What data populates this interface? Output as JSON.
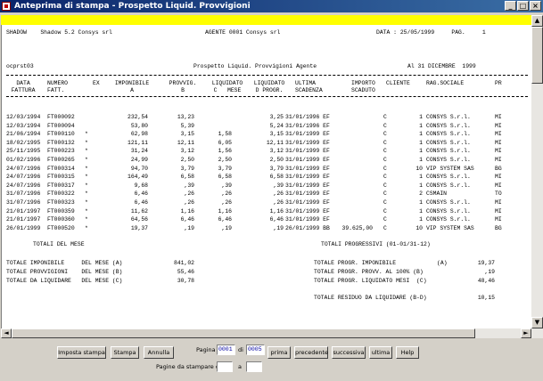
{
  "window": {
    "title": "Anteprima di stampa - Prospetto Liquid. Provvigioni"
  },
  "report": {
    "header_left": "SHADOW    Shadow 5.2 Consys srl",
    "header_mid": "AGENTE 0001 Consys srl",
    "header_right": "DATA : 25/05/1999     PAG.     1",
    "prog": "ocprst03",
    "title": "Prospetto Liquid. Provvigioni Agente",
    "period": "Al 31 DICEMBRE  1999",
    "columns": [
      {
        "l1": "DATA",
        "l2": "FATTURA"
      },
      {
        "l1": "NUMERO",
        "l2": "FATT."
      },
      {
        "l1": "EX",
        "l2": ""
      },
      {
        "l1": "IMPONIBILE",
        "l2": "A"
      },
      {
        "l1": "PROVVIG.",
        "l2": "B"
      },
      {
        "l1": "LIQUIDATO",
        "l2": "C   MESE"
      },
      {
        "l1": "LIQUIDATO",
        "l2": "D PROGR."
      },
      {
        "l1": "ULTIMA",
        "l2": "SCADENZA"
      },
      {
        "l1": "IMPORTO",
        "l2": "SCADUTO"
      },
      {
        "l1": "CLIENTE",
        "l2": ""
      },
      {
        "l1": "RAG.SOCIALE",
        "l2": ""
      },
      {
        "l1": "PR",
        "l2": ""
      }
    ],
    "rows": [
      {
        "data": "12/03/1994",
        "num": "FT000092",
        "ex": "",
        "imp": "232,54",
        "prov": "13,23",
        "liqm": "",
        "liqp": "3,25",
        "scad": "31/01/1996 EF",
        "scaduto": "",
        "c": "C",
        "cli": "1",
        "rag": "CONSYS S.r.l.",
        "pr": "MI"
      },
      {
        "data": "12/03/1994",
        "num": "FT000094",
        "ex": "",
        "imp": "53,80",
        "prov": "5,39",
        "liqm": "",
        "liqp": "5,24",
        "scad": "31/01/1996 EF",
        "scaduto": "",
        "c": "C",
        "cli": "1",
        "rag": "CONSYS S.r.l.",
        "pr": "MI"
      },
      {
        "data": "21/06/1994",
        "num": "FT000110",
        "ex": "*",
        "imp": "62,98",
        "prov": "3,15",
        "liqm": "1,58",
        "liqp": "3,15",
        "scad": "31/01/1999 EF",
        "scaduto": "",
        "c": "C",
        "cli": "1",
        "rag": "CONSYS S.r.l.",
        "pr": "MI"
      },
      {
        "data": "18/02/1995",
        "num": "FT000132",
        "ex": "*",
        "imp": "121,11",
        "prov": "12,11",
        "liqm": "6,05",
        "liqp": "12,11",
        "scad": "31/01/1999 EF",
        "scaduto": "",
        "c": "C",
        "cli": "1",
        "rag": "CONSYS S.r.l.",
        "pr": "MI"
      },
      {
        "data": "25/11/1995",
        "num": "FT000223",
        "ex": "*",
        "imp": "31,24",
        "prov": "3,12",
        "liqm": "1,56",
        "liqp": "3,12",
        "scad": "31/01/1999 EF",
        "scaduto": "",
        "c": "C",
        "cli": "1",
        "rag": "CONSYS S.r.l.",
        "pr": "MI"
      },
      {
        "data": "01/02/1996",
        "num": "FT000265",
        "ex": "*",
        "imp": "24,99",
        "prov": "2,50",
        "liqm": "2,50",
        "liqp": "2,50",
        "scad": "31/01/1999 EF",
        "scaduto": "",
        "c": "C",
        "cli": "1",
        "rag": "CONSYS S.r.l.",
        "pr": "MI"
      },
      {
        "data": "24/07/1996",
        "num": "FT000314",
        "ex": "*",
        "imp": "94,70",
        "prov": "3,79",
        "liqm": "3,79",
        "liqp": "3,79",
        "scad": "31/01/1999 EF",
        "scaduto": "",
        "c": "C",
        "cli": "10",
        "rag": "VIP SYSTEM SAS",
        "pr": "BG"
      },
      {
        "data": "24/07/1996",
        "num": "FT000315",
        "ex": "*",
        "imp": "164,49",
        "prov": "6,58",
        "liqm": "6,58",
        "liqp": "6,58",
        "scad": "31/01/1999 EF",
        "scaduto": "",
        "c": "C",
        "cli": "1",
        "rag": "CONSYS S.r.l.",
        "pr": "MI"
      },
      {
        "data": "24/07/1996",
        "num": "FT000317",
        "ex": "*",
        "imp": "9,68",
        "prov": ",39",
        "liqm": ",39",
        "liqp": ",39",
        "scad": "31/01/1999 EF",
        "scaduto": "",
        "c": "C",
        "cli": "1",
        "rag": "CONSYS S.r.l.",
        "pr": "MI"
      },
      {
        "data": "31/07/1996",
        "num": "FT000322",
        "ex": "*",
        "imp": "6,46",
        "prov": ",26",
        "liqm": ",26",
        "liqp": ",26",
        "scad": "31/01/1999 EF",
        "scaduto": "",
        "c": "C",
        "cli": "2",
        "rag": "CSMAIN",
        "pr": "TO"
      },
      {
        "data": "31/07/1996",
        "num": "FT000323",
        "ex": "*",
        "imp": "6,46",
        "prov": ",26",
        "liqm": ",26",
        "liqp": ",26",
        "scad": "31/01/1999 EF",
        "scaduto": "",
        "c": "C",
        "cli": "1",
        "rag": "CONSYS S.r.l.",
        "pr": "MI"
      },
      {
        "data": "21/01/1997",
        "num": "FT000359",
        "ex": "*",
        "imp": "11,62",
        "prov": "1,16",
        "liqm": "1,16",
        "liqp": "1,16",
        "scad": "31/01/1999 EF",
        "scaduto": "",
        "c": "C",
        "cli": "1",
        "rag": "CONSYS S.r.l.",
        "pr": "MI"
      },
      {
        "data": "21/01/1997",
        "num": "FT000360",
        "ex": "*",
        "imp": "64,56",
        "prov": "6,46",
        "liqm": "6,46",
        "liqp": "6,46",
        "scad": "31/01/1999 EF",
        "scaduto": "",
        "c": "C",
        "cli": "1",
        "rag": "CONSYS S.r.l.",
        "pr": "MI"
      },
      {
        "data": "26/01/1999",
        "num": "FT000520",
        "ex": "*",
        "imp": "19,37",
        "prov": ",19",
        "liqm": ",19",
        "liqp": ",19",
        "scad": "26/01/1999 BB",
        "scaduto": "39.625,00",
        "c": "C",
        "cli": "10",
        "rag": "VIP SYSTEM SAS",
        "pr": "BG"
      }
    ],
    "totals_month_title": "TOTALI DEL MESE",
    "totals_prog_title": "TOTALI PROGRESSIVI (01-01/31-12)",
    "totals_month": [
      {
        "label": "TOTALE IMPONIBILE     DEL MESE (A)",
        "value": "841,02"
      },
      {
        "label": "TOTALE PROVVIGIONI    DEL MESE (B)",
        "value": "55,46"
      },
      {
        "label": "TOTALE DA LIQUIDARE   DEL MESE (C)",
        "value": "30,78"
      }
    ],
    "totals_prog": [
      {
        "label": "TOTALE PROGR. IMPONIBILE            (A)",
        "value": "19,37"
      },
      {
        "label": "TOTALE PROGR. PROVV. AL 100% (B)",
        "value": ",19"
      },
      {
        "label": "TOTALE PROGR. LIQUIDATO MESI  (C)",
        "value": "48,46"
      }
    ],
    "residuo": {
      "label": "TOTALE RESIDUO DA LIQUIDARE (B-D)",
      "value": "10,15"
    }
  },
  "toolbar": {
    "imposta": "Imposta stampa",
    "stampa": "Stampa",
    "annulla": "Annulla",
    "pagina_label": "Pagina",
    "pagina_value": "0001",
    "di_label": "di",
    "di_value": "0005",
    "prima": "prima",
    "precedente": "precedente",
    "successiva": "successiva",
    "ultima": "ultima",
    "help": "Help",
    "da_stampare_label": "Pagine da stampare da",
    "a_label": "a",
    "da_value": "",
    "a_value": ""
  },
  "colors": {
    "title_bar": "#0a246a",
    "highlight": "#ffff00",
    "face": "#d4d0c8"
  }
}
